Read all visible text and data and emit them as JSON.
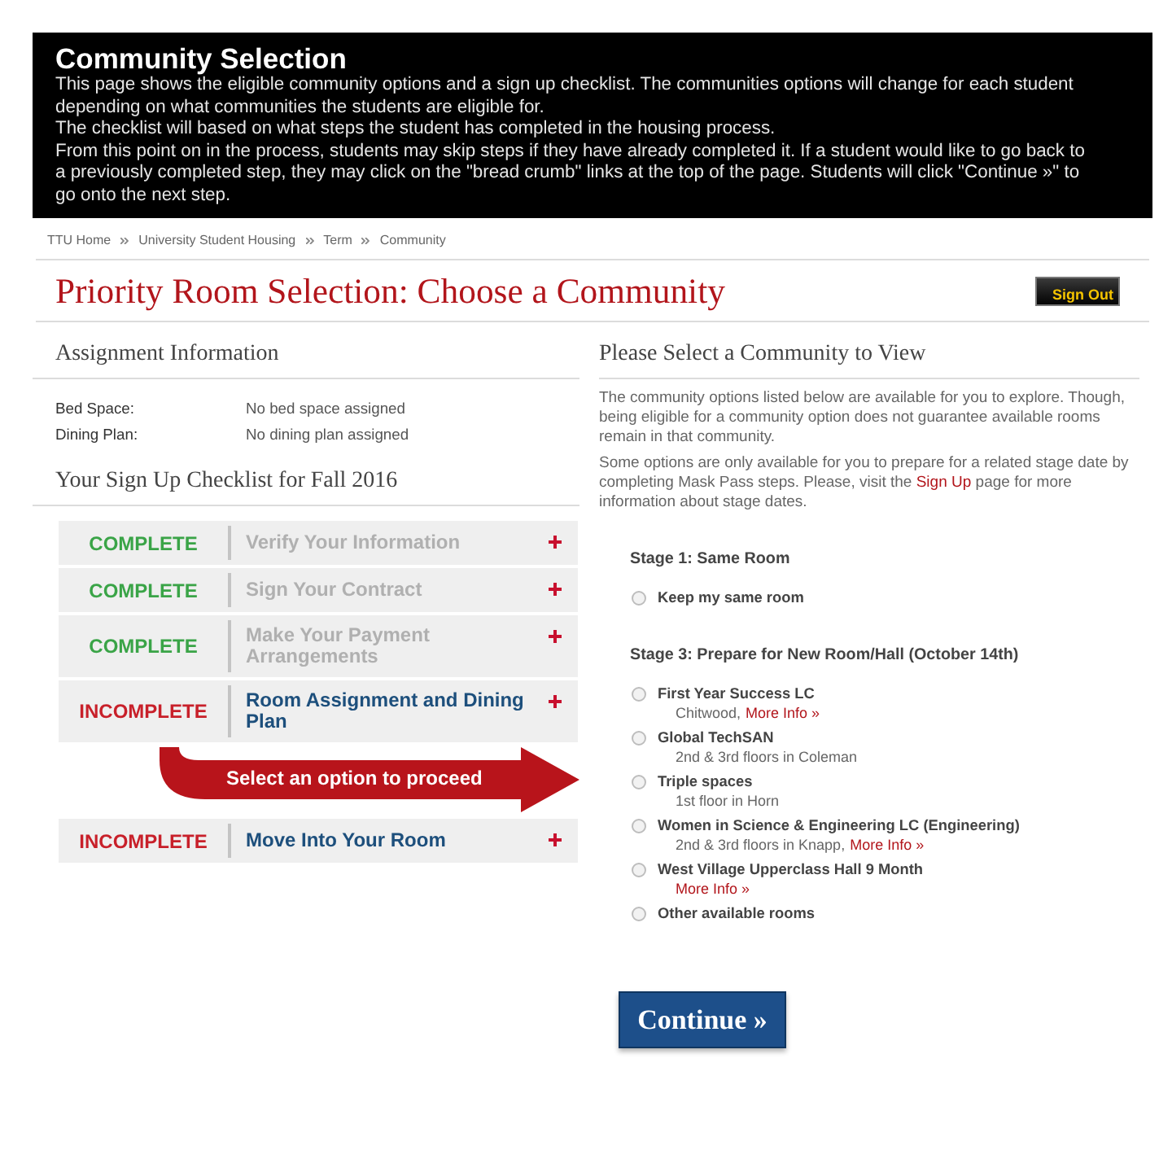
{
  "info_box": {
    "title": "Community Selection",
    "paragraphs": [
      "This page shows the eligible community options and a sign up checklist. The communities options will change for each student depending on what communities the students are eligible for.",
      "The checklist will based on what steps the student has completed in the housing process.",
      "From this point on in the process, students may skip steps if they have already completed it. If a student would like to go back to a previously completed step, they may click on the \"bread crumb\" links at the top of the page. Students will click \"Continue »\" to go onto the next step."
    ]
  },
  "breadcrumb": [
    "TTU Home",
    "University Student Housing",
    "Term",
    "Community"
  ],
  "page_title": "Priority Room Selection: Choose a Community",
  "sign_out_button": {
    "label": "Sign Out"
  },
  "assignment": {
    "heading": "Assignment Information",
    "fields": [
      {
        "label": "Bed Space:",
        "value": "No bed space assigned"
      },
      {
        "label": "Dining Plan:",
        "value": "No dining plan assigned"
      }
    ]
  },
  "checklist": {
    "heading": "Your Sign Up Checklist for Fall 2016",
    "items": [
      {
        "kind": "step",
        "status": "COMPLETE",
        "complete": true,
        "title": "Verify Your Information"
      },
      {
        "kind": "step",
        "status": "COMPLETE",
        "complete": true,
        "title": "Sign Your Contract"
      },
      {
        "kind": "step",
        "status": "COMPLETE",
        "complete": true,
        "title": "Make Your Payment Arrangements"
      },
      {
        "kind": "step",
        "status": "INCOMPLETE",
        "complete": false,
        "title": "Room Assignment and Dining Plan"
      },
      {
        "kind": "prompt",
        "text": "Select an option to proceed"
      },
      {
        "kind": "step",
        "status": "INCOMPLETE",
        "complete": false,
        "title": "Move Into Your Room"
      }
    ]
  },
  "community": {
    "heading": "Please Select a Community to View",
    "intro": "The community options listed below are available for you to explore. Though, being eligible for a community option does not guarantee available rooms remain in that community.",
    "note": {
      "before": "Some options are only available for you to prepare for a related stage date by completing Mask Pass steps. Please, visit the",
      "link": "Sign Up",
      "after": "page for more information about stage dates."
    },
    "stages": [
      {
        "label": "Stage 1: Same Room",
        "options": [
          {
            "name": "Keep my same room",
            "selected": false
          }
        ]
      },
      {
        "label": "Stage 3: Prepare for New Room/Hall (October 14th)",
        "options": [
          {
            "name": "First Year Success LC",
            "detail": "Chitwood,",
            "link": "More Info »",
            "selected": false
          },
          {
            "name": "Global TechSAN",
            "detail": "2nd & 3rd floors in Coleman",
            "selected": false
          },
          {
            "name": "Triple spaces",
            "detail": "1st floor in Horn",
            "selected": false
          },
          {
            "name": "Women in Science & Engineering LC (Engineering)",
            "detail": "2nd & 3rd floors in Knapp,",
            "link": "More Info »",
            "selected": false
          },
          {
            "name": "West Village Upperclass Hall 9 Month",
            "link": "More Info »",
            "selected": false
          },
          {
            "name": "Other available rooms",
            "selected": false
          }
        ]
      }
    ]
  },
  "continue_button": {
    "label": "Continue »"
  }
}
